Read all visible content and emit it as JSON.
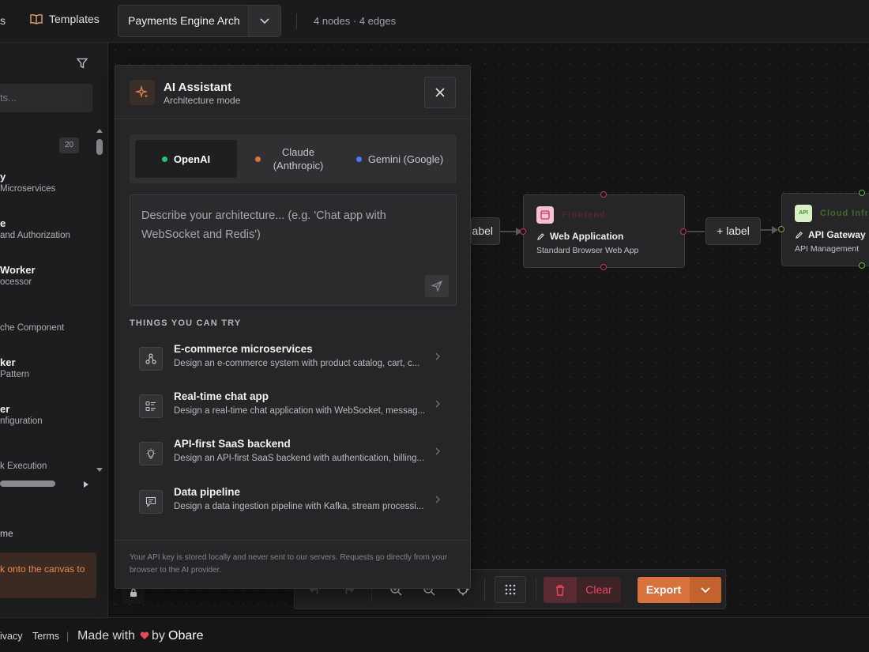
{
  "topbar": {
    "partial_left": "s",
    "templates_label": "Templates",
    "project_name": "Payments Engine Arch",
    "stats": "4 nodes · 4 edges"
  },
  "sidebar": {
    "search_placeholder": "ts...",
    "count": "20",
    "items": [
      {
        "title": "y",
        "desc": "Microservices"
      },
      {
        "title": "e",
        "desc": "and Authorization"
      },
      {
        "title": "Worker",
        "desc": "ocessor"
      },
      {
        "title": "",
        "desc": "che Component"
      },
      {
        "title": "ker",
        "desc": "Pattern"
      },
      {
        "title": "er",
        "desc": "nfiguration"
      },
      {
        "title": "",
        "desc": "k Execution"
      }
    ],
    "footer_label": "me",
    "hint": "k onto the canvas to"
  },
  "canvas": {
    "edge_labels": [
      "abel",
      "+ label"
    ],
    "nodes": [
      {
        "badge": "",
        "category": "Frontend",
        "title": "Web Application",
        "subtitle": "Standard Browser Web App",
        "accent": "#f2a2bd"
      },
      {
        "badge": "API",
        "category": "Cloud Infra",
        "title": "API Gateway",
        "subtitle": "API Management",
        "accent": "#9ad07a"
      }
    ]
  },
  "toolbar": {
    "clear_label": "Clear",
    "export_label": "Export"
  },
  "footer": {
    "privacy": "ivacy",
    "terms": "Terms",
    "sep": "|",
    "made_with": "Made with",
    "by": "by",
    "brand": "Obare"
  },
  "assistant": {
    "title": "AI Assistant",
    "subtitle": "Architecture mode",
    "providers": [
      {
        "label": "OpenAI",
        "color": "#2fbf71"
      },
      {
        "label": "Claude (Anthropic)",
        "color": "#d9733f"
      },
      {
        "label": "Gemini (Google)",
        "color": "#4a7cf0"
      }
    ],
    "prompt_placeholder": "Describe your architecture... (e.g. 'Chat app with WebSocket and Redis')",
    "try_heading": "THINGS YOU CAN TRY",
    "suggestions": [
      {
        "icon": "network-icon",
        "title": "E-commerce microservices",
        "desc": "Design an e-commerce system with product catalog, cart, c..."
      },
      {
        "icon": "list-icon",
        "title": "Real-time chat app",
        "desc": "Design a real-time chat application with WebSocket, messag..."
      },
      {
        "icon": "lightbulb-icon",
        "title": "API-first SaaS backend",
        "desc": "Design an API-first SaaS backend with authentication, billing..."
      },
      {
        "icon": "chat-icon",
        "title": "Data pipeline",
        "desc": "Design a data ingestion pipeline with Kafka, stream processi..."
      }
    ],
    "footnote": "Your API key is stored locally and never sent to our servers. Requests go directly from your browser to the AI provider."
  }
}
